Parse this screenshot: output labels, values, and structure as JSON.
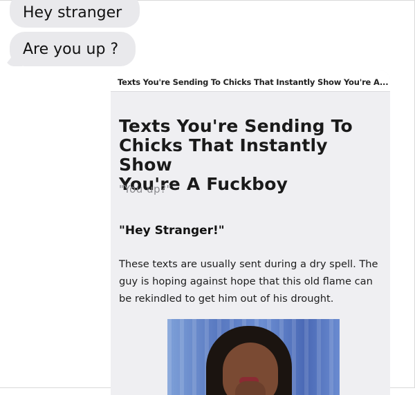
{
  "messages": [
    {
      "text": "Hey stranger"
    },
    {
      "text": "Are you up ?"
    }
  ],
  "link_preview": {
    "header_title": "Texts You're Sending To Chicks That Instantly Show You're A...",
    "article_title_lines": [
      "Texts You're Sending To",
      "Chicks That Instantly Show",
      "You're A Fuckboy"
    ],
    "subtitle": "\"You up?\"",
    "section_heading": "\"Hey Stranger!\"",
    "body_lines": [
      "These texts are usually sent during a dry spell. The",
      "guy is hoping against hope that this old flame can",
      "be rekindled to get him out of his drought."
    ]
  },
  "colors": {
    "bubble_background": "#e9e9ec",
    "card_background": "#efeff2",
    "subtitle_gray": "#8a8a8e"
  }
}
